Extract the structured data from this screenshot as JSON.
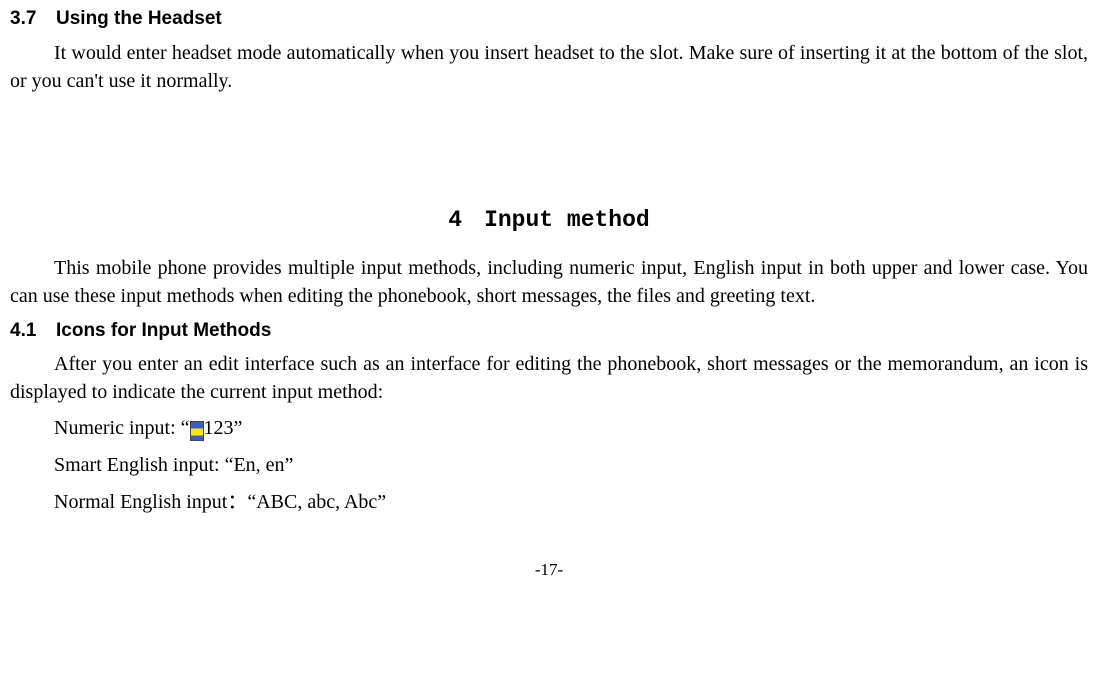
{
  "section37": {
    "number": "3.7",
    "title": "Using the Headset",
    "body": "It would enter headset mode automatically when you insert headset to the slot. Make sure of inserting it at the bottom of the slot, or you can't use it normally."
  },
  "chapter4": {
    "number": "4",
    "title": "Input method",
    "intro": "This mobile phone provides multiple input methods, including numeric input, English input in both upper and lower case. You can use these input methods when editing the phonebook, short messages, the files and greeting text."
  },
  "section41": {
    "number": "4.1",
    "title": "Icons for Input Methods",
    "body": "After you enter an edit interface such as an interface for editing the phonebook, short messages or the memorandum, an icon is displayed to indicate the current input method:",
    "numeric_label": "Numeric input:",
    "numeric_open": "“",
    "numeric_value": "123",
    "numeric_close": "”",
    "smart_label": "Smart English input:",
    "smart_value": "“En, en”",
    "normal_label": "Normal English input：",
    "normal_value": "“ABC, abc, Abc”"
  },
  "page_number": "-17-"
}
